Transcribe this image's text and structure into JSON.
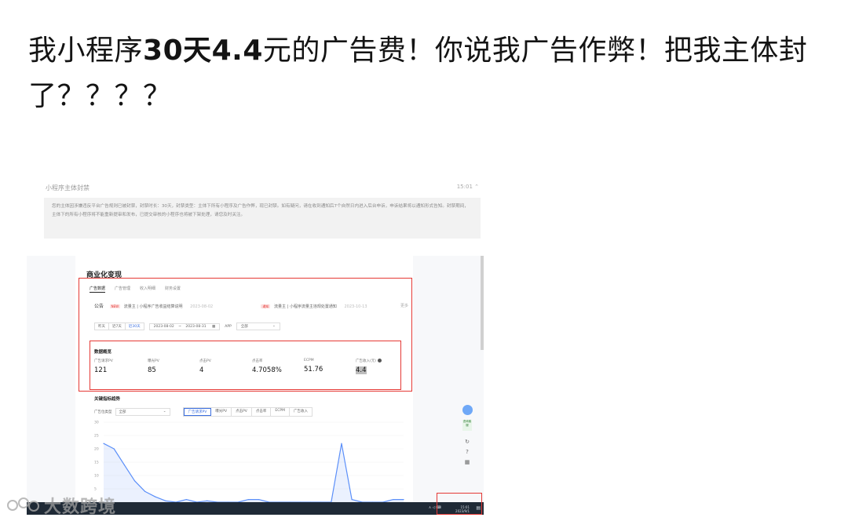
{
  "post": {
    "title_part1": "我小程序",
    "title_bold1": "30天4.4",
    "title_part2": "元的广告费！你说我广告作弊！把我主体封了？？？？"
  },
  "notice": {
    "title": "小程序主体封禁",
    "time": "15:01",
    "body": "您的主体因涉嫌违反平台广告规则已被封禁，封禁时长：30天，封禁类型：主体下所有小程序及广告作弊，现已封禁。如有疑问，请在收到通知后7个自然日内进入后台申诉，申诉结果将以通知形式告知。封禁期间，主体下的所有小程序将不能重新提审和发布，已提交审核的小程序也将被下架处理，请您及时关注。"
  },
  "dashboard": {
    "page_title": "商业化变现",
    "tabs": [
      {
        "label": "广告数据",
        "active": true
      },
      {
        "label": "广告管理",
        "active": false
      },
      {
        "label": "收入明细",
        "active": false
      },
      {
        "label": "财务设置",
        "active": false
      }
    ],
    "announcement": {
      "label": "公告",
      "item1_tag": "NEW",
      "item1_text": "流量主 | 小程序广告收益结算说明",
      "item1_date": "2023-08-02",
      "item2_tag": "通知",
      "item2_text": "流量主 | 小程序流量主违规处置通知",
      "item2_date": "2023-10-13",
      "more": "更多"
    },
    "filters": {
      "range_options": [
        "昨天",
        "近7天",
        "近30天"
      ],
      "date_start": "2023-08-02",
      "date_sep": "~",
      "date_end": "2023-08-31",
      "app_label": "APP",
      "app_value": "全部"
    },
    "summary": {
      "title": "数据概览",
      "metrics": [
        {
          "label": "广告请求PV",
          "value": "121"
        },
        {
          "label": "曝光PV",
          "value": "85"
        },
        {
          "label": "点击PV",
          "value": "4"
        },
        {
          "label": "点击率",
          "value": "4.7058%"
        },
        {
          "label": "ECPM",
          "value": "51.76"
        },
        {
          "label": "广告收入(元)",
          "value": "4.4"
        }
      ]
    },
    "trend": {
      "title": "关键指标趋势",
      "type_label": "广告位类型",
      "type_value": "全部",
      "metric_tabs": [
        {
          "label": "广告请求PV",
          "active": true
        },
        {
          "label": "曝光PV",
          "active": false
        },
        {
          "label": "点击PV",
          "active": false
        },
        {
          "label": "点击率",
          "active": false
        },
        {
          "label": "ECPM",
          "active": false
        },
        {
          "label": "广告收入",
          "active": false
        }
      ]
    },
    "side_tools": {
      "badge": "咨询客服"
    },
    "taskbar": {
      "time": "15:01",
      "date": "2023/9/1"
    }
  },
  "chart_data": {
    "type": "area",
    "title": "",
    "xlabel": "",
    "ylabel": "",
    "ylim": [
      0,
      30
    ],
    "yticks": [
      "30",
      "25",
      "20",
      "15",
      "10",
      "5",
      "0"
    ],
    "series": [
      {
        "values": [
          22,
          20,
          14,
          8,
          4,
          2,
          0.5,
          0,
          1,
          0,
          0.5,
          0,
          0,
          0,
          1,
          1,
          0,
          0,
          0,
          0,
          0,
          0,
          0,
          22,
          1,
          0,
          0,
          0,
          1,
          1
        ]
      }
    ],
    "color": "#5b8ff9"
  },
  "watermark": {
    "text": "大数跨境"
  }
}
